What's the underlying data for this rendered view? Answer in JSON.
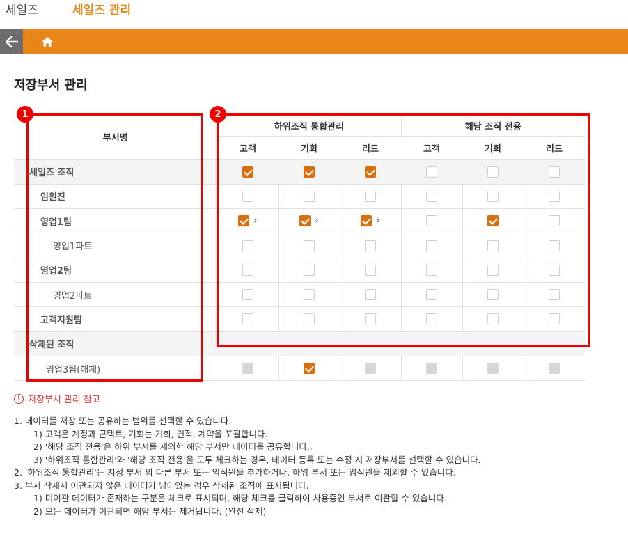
{
  "tabs": [
    {
      "label": "세일즈",
      "active": false
    },
    {
      "label": "세일즈 관리",
      "active": true
    }
  ],
  "nav": {
    "back_icon": "arrow-left-icon",
    "home_icon": "home-icon"
  },
  "page_title": "저장부서 관리",
  "badges": [
    "1",
    "2"
  ],
  "table": {
    "dept_header": "부서명",
    "group1": "하위조직 통합관리",
    "group2": "해당 조직 전용",
    "subcols": [
      "고객",
      "기회",
      "리드",
      "고객",
      "기회",
      "리드"
    ],
    "rows": [
      {
        "name": "세일즈 조직",
        "level": 0,
        "shade": true,
        "checks": [
          "on",
          "on",
          "on",
          "off",
          "off",
          "off"
        ],
        "arrows": [
          false,
          false,
          false
        ]
      },
      {
        "name": "임원진",
        "level": 1,
        "shade": false,
        "checks": [
          "off",
          "off",
          "off",
          "off",
          "off",
          "off"
        ],
        "arrows": [
          false,
          false,
          false
        ]
      },
      {
        "name": "영업1팀",
        "level": 1,
        "shade": false,
        "checks": [
          "on",
          "on",
          "on",
          "off",
          "on",
          "off"
        ],
        "arrows": [
          true,
          true,
          true
        ]
      },
      {
        "name": "영업1파트",
        "level": 2,
        "shade": false,
        "checks": [
          "off",
          "off",
          "off",
          "off",
          "off",
          "off"
        ],
        "arrows": [
          false,
          false,
          false
        ]
      },
      {
        "name": "영업2팀",
        "level": 1,
        "shade": false,
        "checks": [
          "off",
          "off",
          "off",
          "off",
          "off",
          "off"
        ],
        "arrows": [
          false,
          false,
          false
        ]
      },
      {
        "name": "영업2파트",
        "level": 2,
        "shade": false,
        "checks": [
          "off",
          "off",
          "off",
          "off",
          "off",
          "off"
        ],
        "arrows": [
          false,
          false,
          false
        ]
      },
      {
        "name": "고객지원팀",
        "level": 1,
        "shade": false,
        "checks": [
          "off",
          "off",
          "off",
          "off",
          "off",
          "off"
        ],
        "arrows": [
          false,
          false,
          false
        ]
      },
      {
        "name": "삭제된 조직",
        "level": 0,
        "shade": true,
        "checks": null,
        "arrows": [
          false,
          false,
          false
        ]
      },
      {
        "name": "영업3팀(해체)",
        "level": 3,
        "shade": false,
        "checks": [
          "dis",
          "on",
          "dis",
          "dis",
          "dis",
          "dis"
        ],
        "arrows": [
          false,
          false,
          false
        ]
      }
    ]
  },
  "notes": {
    "title": "저장부서 관리 참고",
    "lines": [
      {
        "text": "1. 데이터를 저장 또는 공유하는 범위를 선택할 수 있습니다.",
        "indent": false
      },
      {
        "text": "1) 고객은 계정과 콘택트, 기회는 기회, 견적, 계약을 포괄합니다.",
        "indent": true
      },
      {
        "text": "2) '해당 조직 전용'은 하위 부서를 제외한 해당 부서만 데이터를 공유합니다..",
        "indent": true
      },
      {
        "text": "3) '하위조직 통합관리'와 '해당 조직 전용'을 모두 체크하는 경우, 데이터 등록 또는 수정 시 저장부서를 선택할 수 있습니다.",
        "indent": true
      },
      {
        "text": "2. '하위조직 통합관리'는 지정 부서 외 다른 부서 또는 임직원을 추가하거나, 하위 부서 또는 임직원을 제외할 수 있습니다.",
        "indent": false
      },
      {
        "text": "3. 부서 삭제시 이관되지 않은 데이터가 남아있는 경우 삭제된 조직에 표시됩니다.",
        "indent": false
      },
      {
        "text": "1) 미이관 데이터가 존재하는 구분은 체크로 표시되며, 해당 체크를 클릭하여 사용중인 부서로 이관할 수 있습니다.",
        "indent": true
      },
      {
        "text": "2) 모든 데이터가 이관되면 해당 부서는 제거됩니다. (완전 삭제)",
        "indent": true
      }
    ]
  },
  "colors": {
    "accent": "#e8861a",
    "check": "#d8700f",
    "annotation": "#ee0000",
    "back_button": "#6d6d6d"
  }
}
